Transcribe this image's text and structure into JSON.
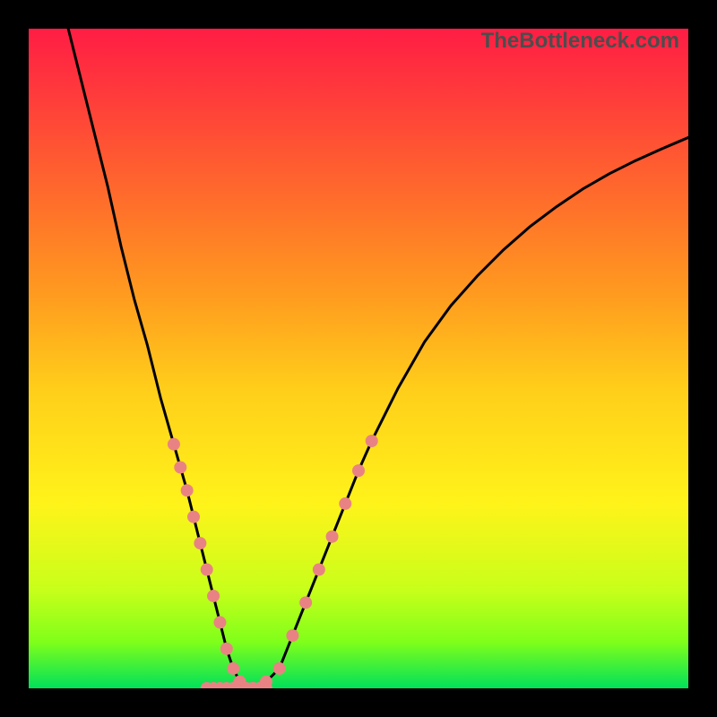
{
  "dimensions": {
    "outer": 800,
    "inner": 736,
    "margin": 32
  },
  "watermark": "TheBottleneck.com",
  "gradient": {
    "stops": [
      {
        "offset": 0.0,
        "color": "#ff1d44"
      },
      {
        "offset": 0.1,
        "color": "#ff3b3b"
      },
      {
        "offset": 0.25,
        "color": "#ff6a2c"
      },
      {
        "offset": 0.4,
        "color": "#ff9a1f"
      },
      {
        "offset": 0.55,
        "color": "#ffcf1a"
      },
      {
        "offset": 0.72,
        "color": "#fff31a"
      },
      {
        "offset": 0.85,
        "color": "#c8ff1a"
      },
      {
        "offset": 0.93,
        "color": "#7fff1a"
      },
      {
        "offset": 1.0,
        "color": "#00e05a"
      }
    ]
  },
  "chart_data": {
    "type": "line",
    "title": "",
    "xlabel": "",
    "ylabel": "",
    "xlim": [
      0,
      100
    ],
    "ylim": [
      0,
      100
    ],
    "x": [
      6,
      8,
      10,
      12,
      14,
      16,
      18,
      20,
      22,
      23,
      24,
      25,
      26,
      27,
      28,
      29,
      30,
      31,
      32,
      34,
      36,
      38,
      40,
      42,
      44,
      46,
      48,
      50,
      52,
      54,
      56,
      58,
      60,
      64,
      68,
      72,
      76,
      80,
      84,
      88,
      92,
      96,
      100
    ],
    "y": [
      100,
      92,
      84,
      76,
      67,
      59,
      52,
      44,
      37,
      33.5,
      30,
      26,
      22,
      18,
      14,
      10,
      6,
      3,
      1,
      0,
      1,
      3,
      8,
      13,
      18,
      23,
      28,
      33,
      37.5,
      41.5,
      45.5,
      49,
      52.5,
      58,
      62.5,
      66.5,
      70,
      73,
      75.7,
      78,
      80,
      81.8,
      83.5
    ],
    "marker_band": {
      "y_min": 0,
      "y_max": 38,
      "color": "#e98383",
      "radius_px": 7
    },
    "bottom_markers_x": [
      27,
      28,
      29,
      30,
      31,
      32,
      33,
      34,
      35,
      36
    ]
  }
}
